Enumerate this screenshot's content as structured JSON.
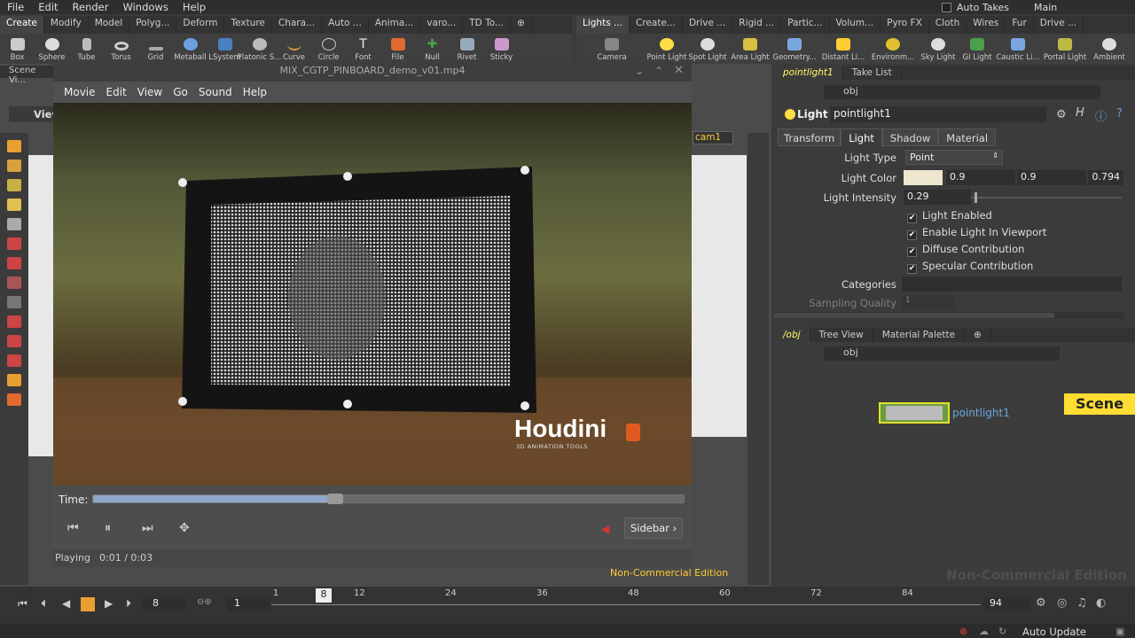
{
  "menubar": {
    "items": [
      "File",
      "Edit",
      "Render",
      "Windows",
      "Help"
    ],
    "auto_takes": "Auto Takes",
    "desktop": "Main"
  },
  "shelf_left": {
    "tabs": [
      "Create",
      "Modify",
      "Model",
      "Polyg...",
      "Deform",
      "Texture",
      "Chara...",
      "Auto ...",
      "Anima...",
      "varo...",
      "TD To..."
    ],
    "tools": [
      "Box",
      "Sphere",
      "Tube",
      "Torus",
      "Grid",
      "Metaball",
      "LSystem",
      "Platonic S...",
      "Curve",
      "Circle",
      "Font",
      "File",
      "Null",
      "Rivet",
      "Sticky"
    ]
  },
  "shelf_right": {
    "tabs": [
      "Lights ...",
      "Create...",
      "Drive ...",
      "Rigid ...",
      "Partic...",
      "Volum...",
      "Pyro FX",
      "Cloth",
      "Wires",
      "Fur",
      "Drive ..."
    ],
    "tools": [
      "Camera",
      "Point Light",
      "Spot Light",
      "Area Light",
      "Geometry...",
      "Distant Li...",
      "Environm...",
      "Sky Light",
      "GI Light",
      "Caustic Li...",
      "Portal Light",
      "Ambient"
    ]
  },
  "viewport": {
    "tab_label": "Scene Vi...",
    "view_label": "View",
    "camera": "cam1",
    "edition": "Non-Commercial Edition"
  },
  "player": {
    "title": "MIX_CGTP_PINBOARD_demo_v01.mp4",
    "menu": [
      "Movie",
      "Edit",
      "View",
      "Go",
      "Sound",
      "Help"
    ],
    "brand": "Houdini",
    "brand_sub": "3D ANIMATION TOOLS",
    "time_label": "Time:",
    "progress": 0.41,
    "sidebar_label": "Sidebar",
    "status": "Playing",
    "time": "0:01 / 0:03"
  },
  "params": {
    "tabs": [
      "pointlight1",
      "Take List"
    ],
    "path": "obj",
    "node_type": "Light",
    "node_name": "pointlight1",
    "subtabs": [
      "Transform",
      "Light",
      "Shadow",
      "Material"
    ],
    "light_type_label": "Light Type",
    "light_type": "Point",
    "light_color_label": "Light Color",
    "light_color": [
      "0.9",
      "0.9",
      "0.794"
    ],
    "light_color_swatch": "#efe6cf",
    "light_intensity_label": "Light Intensity",
    "light_intensity": "0.29",
    "checks": [
      "Light Enabled",
      "Enable Light In Viewport",
      "Diffuse Contribution",
      "Specular Contribution"
    ],
    "categories_label": "Categories",
    "sampling_label": "Sampling Quality",
    "sampling_value": "1"
  },
  "network": {
    "tabs": [
      "/obj",
      "Tree View",
      "Material Palette"
    ],
    "path": "obj",
    "context_label": "Scene",
    "node_label": "pointlight1",
    "edition_watermark": "Non-Commercial Edition"
  },
  "timeline": {
    "current_frame": "8",
    "start_frame": "1",
    "end_frame": "94",
    "ticks": [
      "1",
      "12",
      "24",
      "36",
      "48",
      "60",
      "72",
      "84"
    ],
    "playhead": "8"
  },
  "status": {
    "auto_update": "Auto Update"
  }
}
